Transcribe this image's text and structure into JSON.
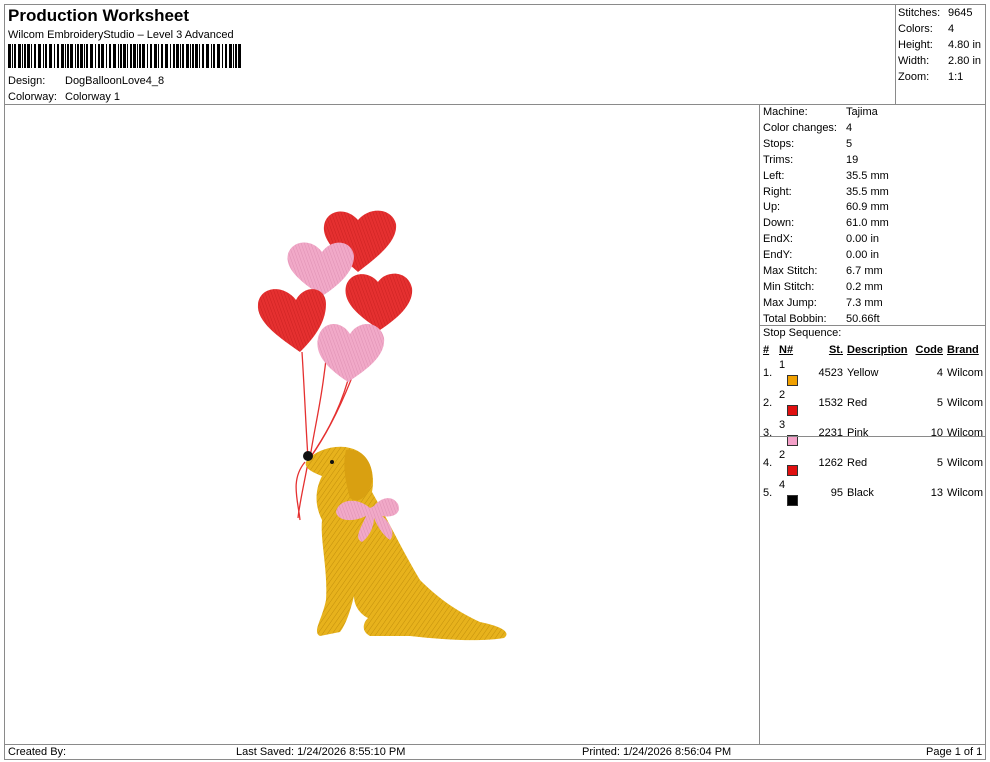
{
  "header": {
    "title": "Production Worksheet",
    "subtitle": "Wilcom EmbroideryStudio – Level 3 Advanced",
    "design_label": "Design:",
    "design_value": "DogBalloonLove4_8",
    "colorway_label": "Colorway:",
    "colorway_value": "Colorway 1"
  },
  "summary": [
    {
      "label": "Stitches:",
      "value": "9645"
    },
    {
      "label": "Colors:",
      "value": "4"
    },
    {
      "label": "Height:",
      "value": "4.80 in"
    },
    {
      "label": "Width:",
      "value": "2.80 in"
    },
    {
      "label": "Zoom:",
      "value": "1:1"
    }
  ],
  "machine_info": [
    {
      "label": "Machine:",
      "value": "Tajima"
    },
    {
      "label": "Color changes:",
      "value": "4"
    },
    {
      "label": "Stops:",
      "value": "5"
    },
    {
      "label": "Trims:",
      "value": "19"
    },
    {
      "label": "Left:",
      "value": "35.5 mm"
    },
    {
      "label": "Right:",
      "value": "35.5 mm"
    },
    {
      "label": "Up:",
      "value": "60.9 mm"
    },
    {
      "label": "Down:",
      "value": "61.0 mm"
    },
    {
      "label": "EndX:",
      "value": "0.00 in"
    },
    {
      "label": "EndY:",
      "value": "0.00 in"
    },
    {
      "label": "Max Stitch:",
      "value": "6.7 mm"
    },
    {
      "label": "Min Stitch:",
      "value": "0.2 mm"
    },
    {
      "label": "Max Jump:",
      "value": "7.3 mm"
    },
    {
      "label": "Total Bobbin:",
      "value": "50.66ft"
    }
  ],
  "stop_sequence": {
    "title": "Stop Sequence:",
    "headers": {
      "num": "#",
      "n": "N#",
      "st": "St.",
      "desc": "Description",
      "code": "Code",
      "brand": "Brand"
    },
    "rows": [
      {
        "num": "1.",
        "n": "1",
        "color": "#f0a000",
        "st": "4523",
        "desc": "Yellow",
        "code": "4",
        "brand": "Wilcom"
      },
      {
        "num": "2.",
        "n": "2",
        "color": "#e01010",
        "st": "1532",
        "desc": "Red",
        "code": "5",
        "brand": "Wilcom"
      },
      {
        "num": "3.",
        "n": "3",
        "color": "#f4a0c8",
        "st": "2231",
        "desc": "Pink",
        "code": "10",
        "brand": "Wilcom"
      },
      {
        "num": "4.",
        "n": "2",
        "color": "#e01010",
        "st": "1262",
        "desc": "Red",
        "code": "5",
        "brand": "Wilcom"
      },
      {
        "num": "5.",
        "n": "4",
        "color": "#000000",
        "st": "95",
        "desc": "Black",
        "code": "13",
        "brand": "Wilcom"
      }
    ]
  },
  "footer": {
    "created": "Created By:",
    "saved": "Last Saved: 1/24/2026 8:55:10 PM",
    "printed": "Printed: 1/24/2026 8:56:04 PM",
    "page": "Page 1 of 1"
  },
  "colors": {
    "yellow": "#e8b218",
    "red": "#e32a2a",
    "pink": "#f0a6c6",
    "black": "#111111"
  }
}
